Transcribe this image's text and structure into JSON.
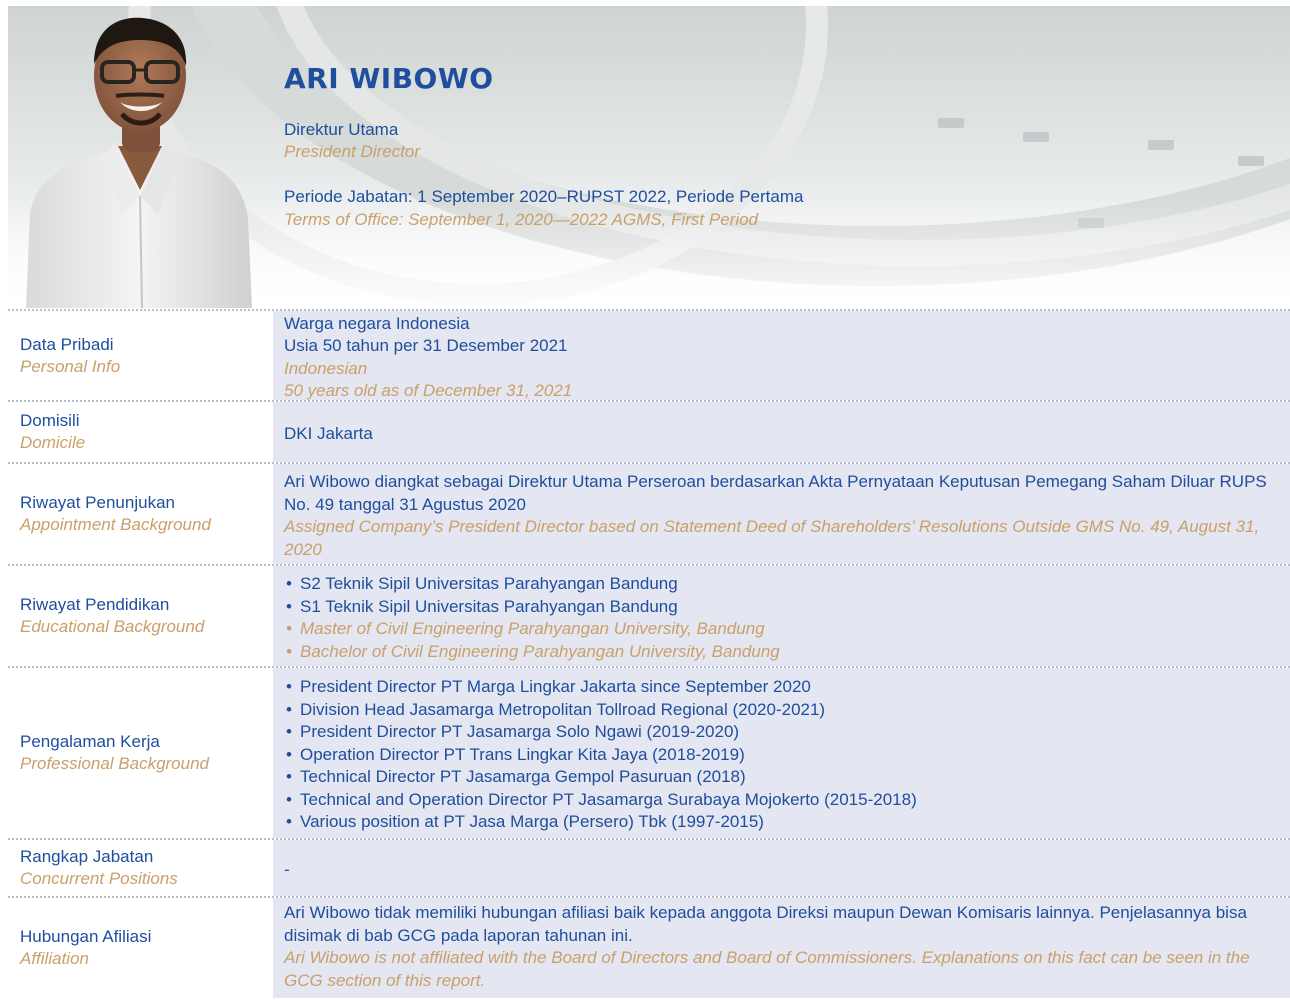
{
  "profile": {
    "name": "ARI WIBOWO",
    "position_id": "Direktur Utama",
    "position_en": "President Director",
    "term_id": "Periode Jabatan: 1 September 2020–RUPST 2022, Periode Pertama",
    "term_en": "Terms of Office: September 1, 2020—2022 AGMS, First Period"
  },
  "rows": {
    "personal": {
      "label_id": "Data Pribadi",
      "label_en": "Personal Info",
      "value_id": [
        "Warga negara Indonesia",
        "Usia 50 tahun per 31 Desember 2021"
      ],
      "value_en": [
        "Indonesian",
        "50 years old as of December 31, 2021"
      ]
    },
    "domicile": {
      "label_id": "Domisili",
      "label_en": "Domicile",
      "value": "DKI Jakarta"
    },
    "appointment": {
      "label_id": "Riwayat Penunjukan",
      "label_en": "Appointment Background",
      "value_id": "Ari Wibowo diangkat sebagai Direktur Utama Perseroan berdasarkan Akta Pernyataan Keputusan Pemegang Saham Diluar RUPS No. 49 tanggal 31 Agustus 2020",
      "value_en": "Assigned Company’s President Director based on Statement Deed of Shareholders’ Resolutions Outside GMS No. 49, August 31, 2020"
    },
    "education": {
      "label_id": "Riwayat Pendidikan",
      "label_en": "Educational Background",
      "items_id": [
        "S2 Teknik Sipil Universitas Parahyangan Bandung",
        "S1 Teknik Sipil Universitas Parahyangan Bandung"
      ],
      "items_en": [
        "Master of Civil Engineering Parahyangan University, Bandung",
        "Bachelor of Civil Engineering Parahyangan University, Bandung"
      ]
    },
    "professional": {
      "label_id": "Pengalaman Kerja",
      "label_en": "Professional Background",
      "items": [
        "President Director PT Marga Lingkar Jakarta since September 2020",
        "Division Head Jasamarga Metropolitan Tollroad Regional (2020-2021)",
        "President Director PT Jasamarga Solo Ngawi (2019-2020)",
        "Operation Director PT Trans Lingkar Kita Jaya (2018-2019)",
        "Technical Director PT Jasamarga Gempol Pasuruan (2018)",
        "Technical and Operation Director PT Jasamarga Surabaya Mojokerto (2015-2018)",
        "Various position at PT Jasa Marga (Persero) Tbk (1997-2015)"
      ]
    },
    "concurrent": {
      "label_id": "Rangkap Jabatan",
      "label_en": "Concurrent Positions",
      "value": "-"
    },
    "affiliation": {
      "label_id": "Hubungan Afiliasi",
      "label_en": "Affiliation",
      "value_id": "Ari Wibowo tidak memiliki hubungan afiliasi baik kepada anggota Direksi maupun Dewan Komisaris lainnya. Penjelasannya bisa disimak di bab GCG pada laporan tahunan ini.",
      "value_en": "Ari Wibowo is not affiliated with the Board of Directors and Board of Commissioners. Explanations on this fact can be seen in the GCG section of this report."
    }
  },
  "colors": {
    "primary": "#1f4e9c",
    "accent": "#c9a06a",
    "row_bg": "#e4e6f1"
  }
}
